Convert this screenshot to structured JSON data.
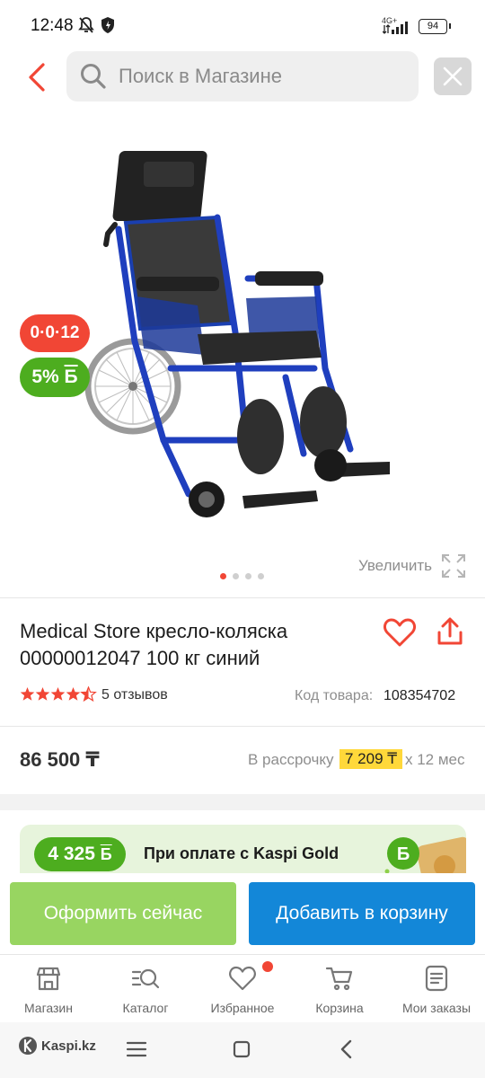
{
  "status_bar": {
    "time": "12:48",
    "network": "4G+",
    "battery": "94"
  },
  "search": {
    "placeholder": "Поиск в Магазине"
  },
  "product": {
    "badge_installment": "0·0·12",
    "badge_bonus": "5%",
    "bonus_symbol": "Б",
    "zoom_label": "Увеличить",
    "image_count": 4,
    "active_image": 1,
    "title": "Medical Store кресло-коляска 00000012047 100 кг синий",
    "rating": 4.5,
    "reviews": "5 отзывов",
    "code_label": "Код товара:",
    "code": "108354702",
    "price": "86 500 ₸",
    "installment_label": "В рассрочку",
    "installment_value": "7 209 ₸",
    "installment_term": "x 12 мес"
  },
  "promo": {
    "bonus": "4 325",
    "bonus_symbol": "Б",
    "text": "При оплате с Kaspi Gold"
  },
  "actions": {
    "buy_now": "Оформить сейчас",
    "add_to_cart": "Добавить в корзину"
  },
  "nav": [
    {
      "label": "Магазин",
      "icon": "shop-icon"
    },
    {
      "label": "Каталог",
      "icon": "catalog-search-icon"
    },
    {
      "label": "Избранное",
      "icon": "heart-icon"
    },
    {
      "label": "Корзина",
      "icon": "cart-icon"
    },
    {
      "label": "Мои заказы",
      "icon": "orders-icon"
    }
  ],
  "system": {
    "brand": "Kaspi.kz"
  },
  "colors": {
    "accent_red": "#f14635",
    "bonus_green": "#4dad1f",
    "cart_blue": "#1387d8",
    "buy_green": "#98d561",
    "installment_yellow": "#ffd83a"
  }
}
